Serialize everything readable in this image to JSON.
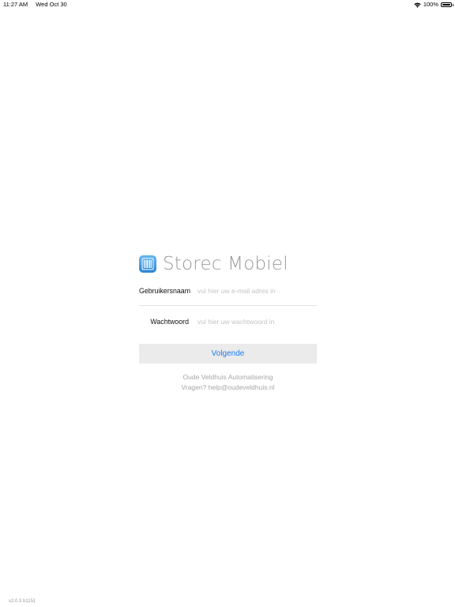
{
  "status_bar": {
    "time": "11:27 AM",
    "date": "Wed Oct 30",
    "battery": "100%",
    "wifi_icon": "wifi-icon",
    "battery_icon": "battery-icon"
  },
  "brand": {
    "icon": "storec-app-icon",
    "title": "Storec Mobiel",
    "icon_colors": [
      "#66b8f2",
      "#2a84d6"
    ]
  },
  "form": {
    "username": {
      "label": "Gebruikersnaam",
      "placeholder": "vul hier uw e-mail adres in",
      "value": ""
    },
    "password": {
      "label": "Wachtwoord",
      "placeholder": "vul hier uw wachtwoord in",
      "value": ""
    },
    "submit_label": "Volgende",
    "accent_color": "#1c7cf0"
  },
  "footer": {
    "company": "Oude Veldhuis Automatisering",
    "contact": "Vragen? help@oudeveldhuis.nl"
  },
  "version": "v2.0.3 b1151"
}
